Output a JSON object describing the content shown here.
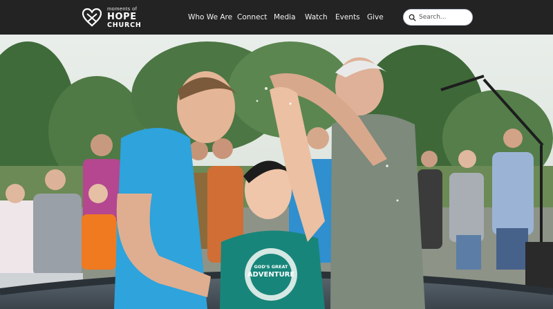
{
  "brand": {
    "line1": "moments of",
    "line2": "HOPE",
    "line3": "CHURCH",
    "text_color": "#ffffff"
  },
  "nav": {
    "items": [
      {
        "label": "Who We Are"
      },
      {
        "label": "Connect"
      },
      {
        "label": "Media"
      },
      {
        "label": "Watch"
      },
      {
        "label": "Events"
      },
      {
        "label": "Give"
      }
    ]
  },
  "search": {
    "placeholder": "Search..."
  },
  "hero": {
    "shirt_text_top": "GOD'S GREAT",
    "shirt_text_main": "ADVENTURE",
    "colors": {
      "header_bg": "#232323",
      "blue_shirt": "#2ea3dc",
      "teal_shirt": "#18857a",
      "gray_shirt": "#7d8a7c"
    }
  }
}
